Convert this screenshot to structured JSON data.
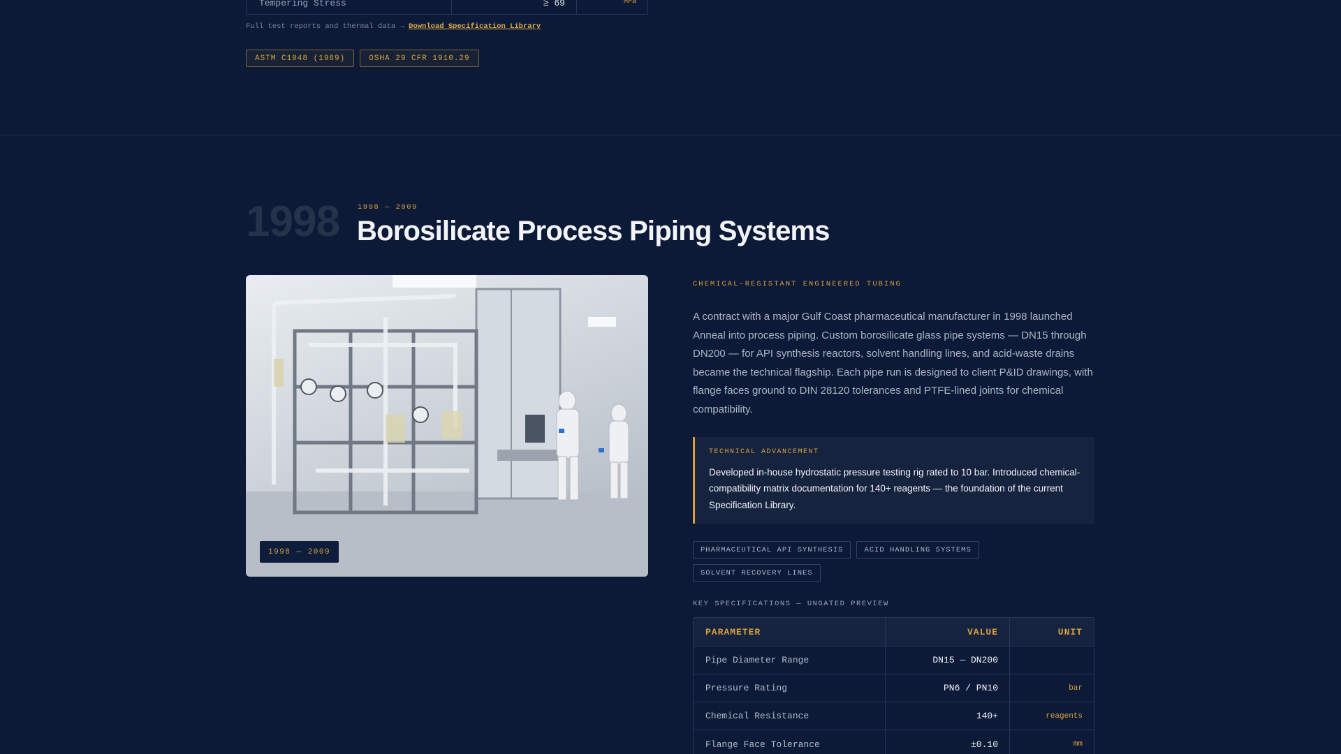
{
  "top": {
    "row": {
      "parameter": "Tempering Stress",
      "value": "≥ 69",
      "unit": "MPa"
    },
    "note_prefix": "Full test reports and thermal data →",
    "note_link": "Download Specification Library",
    "badges": [
      "ASTM C1048 (1989)",
      "OSHA 29 CFR 1910.29"
    ]
  },
  "section": {
    "year": "1998",
    "era": "1998 — 2009",
    "title": "Borosilicate Process Piping Systems",
    "image_badge": "1998 — 2009",
    "eyebrow": "CHEMICAL-RESISTANT ENGINEERED TUBING",
    "description": "A contract with a major Gulf Coast pharmaceutical manufacturer in 1998 launched Anneal into process piping. Custom borosilicate glass pipe systems — DN15 through DN200 — for API synthesis reactors, solvent handling lines, and acid-waste drains became the technical flagship. Each pipe run is designed to client P&ID drawings, with flange faces ground to DIN 28120 tolerances and PTFE-lined joints for chemical compatibility.",
    "callout": {
      "label": "TECHNICAL ADVANCEMENT",
      "text": "Developed in-house hydrostatic pressure testing rig rated to 10 bar. Introduced chemical-compatibility matrix documentation for 140+ reagents — the foundation of the current Specification Library."
    },
    "tags": [
      "PHARMACEUTICAL API SYNTHESIS",
      "ACID HANDLING SYSTEMS",
      "SOLVENT RECOVERY LINES"
    ],
    "spec_label": "KEY SPECIFICATIONS — UNGATED PREVIEW",
    "spec_headers": {
      "parameter": "PARAMETER",
      "value": "VALUE",
      "unit": "UNIT"
    },
    "spec_rows": [
      {
        "parameter": "Pipe Diameter Range",
        "value": "DN15 — DN200",
        "unit": ""
      },
      {
        "parameter": "Pressure Rating",
        "value": "PN6 / PN10",
        "unit": "bar"
      },
      {
        "parameter": "Chemical Resistance",
        "value": "140+",
        "unit": "reagents"
      },
      {
        "parameter": "Flange Face Tolerance",
        "value": "±0.10",
        "unit": "mm"
      }
    ]
  },
  "colors": {
    "background": "#0c1a38",
    "accent": "#d9a23a",
    "panel": "#15233f"
  }
}
